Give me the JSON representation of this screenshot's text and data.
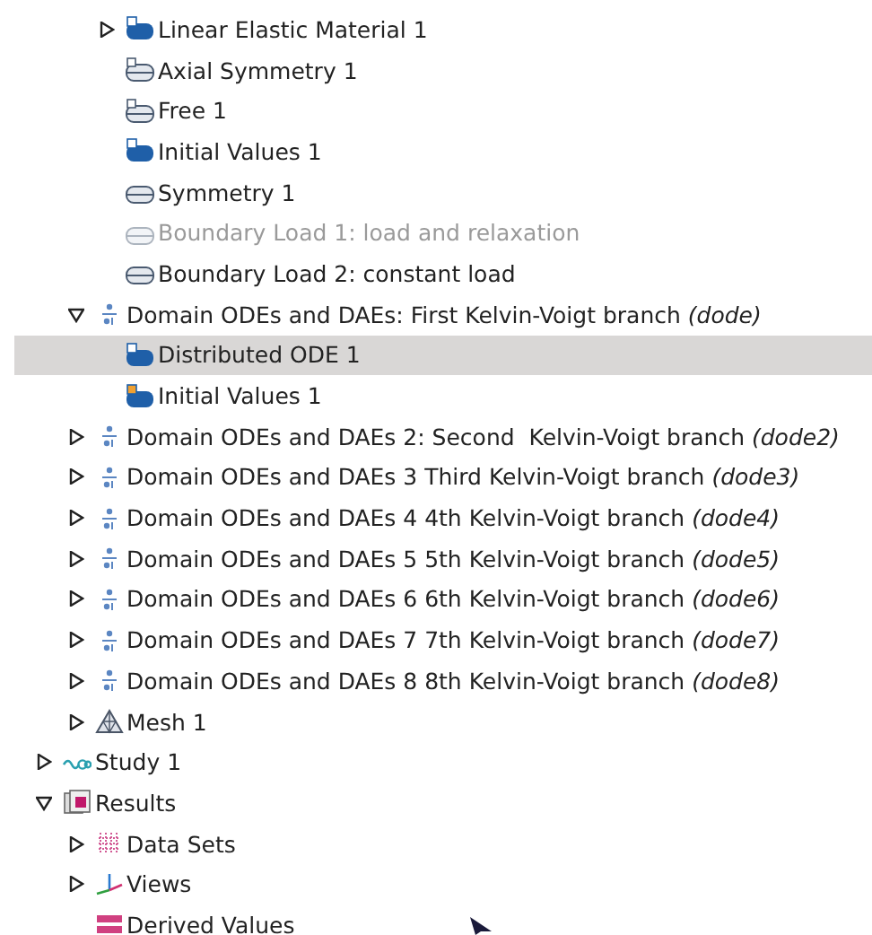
{
  "tree": [
    {
      "children": [
        {
          "children": [
            {
              "label": "Linear Elastic Material 1",
              "kind": "material",
              "expanded": false,
              "selected": false,
              "disabled": false
            },
            {
              "label": "Axial Symmetry 1",
              "kind": "boundary-d",
              "selected": false,
              "disabled": false
            },
            {
              "label": "Free 1",
              "kind": "boundary-d",
              "selected": false,
              "disabled": false
            },
            {
              "label": "Initial Values 1",
              "kind": "material",
              "selected": false,
              "disabled": false
            },
            {
              "label": "Symmetry 1",
              "kind": "boundary",
              "selected": false,
              "disabled": false
            },
            {
              "label": "Boundary Load 1: load and relaxation",
              "kind": "boundary",
              "selected": false,
              "disabled": true
            },
            {
              "label": "Boundary Load 2: constant load",
              "kind": "boundary",
              "selected": false,
              "disabled": false
            }
          ]
        },
        {
          "label": "Domain ODEs and DAEs: First Kelvin-Voigt branch *(dode)*",
          "kind": "ode",
          "expanded": true,
          "selected": false,
          "children": [
            {
              "label": "Distributed ODE 1",
              "kind": "material",
              "selected": true
            },
            {
              "label": "Initial Values 1",
              "kind": "initial",
              "selected": false
            }
          ]
        },
        {
          "label": "Domain ODEs and DAEs 2: Second  Kelvin-Voigt branch *(dode2)*",
          "kind": "ode",
          "expanded": false,
          "selected": false
        },
        {
          "label": "Domain ODEs and DAEs 3 Third Kelvin-Voigt branch *(dode3)*",
          "kind": "ode",
          "expanded": false,
          "selected": false
        },
        {
          "label": "Domain ODEs and DAEs 4 4th Kelvin-Voigt branch *(dode4)*",
          "kind": "ode",
          "expanded": false,
          "selected": false
        },
        {
          "label": "Domain ODEs and DAEs 5 5th Kelvin-Voigt branch *(dode5)*",
          "kind": "ode",
          "expanded": false,
          "selected": false
        },
        {
          "label": "Domain ODEs and DAEs 6 6th Kelvin-Voigt branch *(dode6)*",
          "kind": "ode",
          "expanded": false,
          "selected": false
        },
        {
          "label": "Domain ODEs and DAEs 7 7th Kelvin-Voigt branch *(dode7)*",
          "kind": "ode",
          "expanded": false,
          "selected": false
        },
        {
          "label": "Domain ODEs and DAEs 8 8th Kelvin-Voigt branch *(dode8)*",
          "kind": "ode",
          "expanded": false,
          "selected": false
        },
        {
          "label": "Mesh 1",
          "kind": "mesh",
          "expanded": false,
          "selected": false
        }
      ]
    },
    {
      "label": "Study 1",
      "kind": "study",
      "expanded": false,
      "selected": false
    },
    {
      "label": "Results",
      "kind": "results",
      "expanded": true,
      "selected": false,
      "children": [
        {
          "label": "Data Sets",
          "kind": "datasets",
          "expanded": false,
          "selected": false
        },
        {
          "label": "Views",
          "kind": "views",
          "expanded": false,
          "selected": false
        },
        {
          "label": "Derived Values",
          "kind": "derived",
          "selected": false
        }
      ]
    }
  ]
}
